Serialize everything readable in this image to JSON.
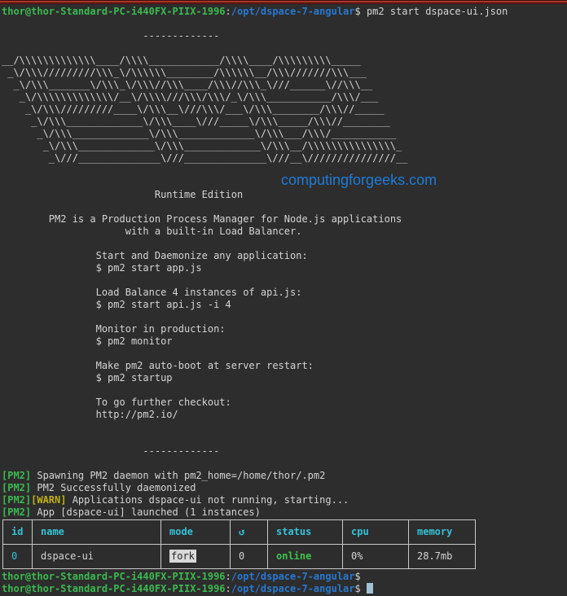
{
  "colors": {
    "background": "#2d2d2d",
    "foreground": "#d4d4d4",
    "prompt_green": "#3cb950",
    "path_blue": "#2878d0",
    "warn_yellow": "#c3b118",
    "table_cyan": "#36c2d8",
    "online_green": "#3fc24c",
    "watermark_blue": "#1e7cd8",
    "window_edge_red": "#a53527"
  },
  "watermark": "computingforgeeks.com",
  "prompt": {
    "user_host": "thor@thor-Standard-PC-i440FX-PIIX-1996",
    "colon": ":",
    "path": "/opt/dspace-7-angular",
    "dollar": "$"
  },
  "command_line": "$ pm2 start dspace-ui.json",
  "banner_and_help": [
    "",
    "",
    "                        -------------",
    "",
    "__/\\\\\\\\\\\\\\\\\\\\\\\\\\____/\\\\\\\\____________/\\\\\\\\____/\\\\\\\\\\\\\\\\\\_____",
    " _\\/\\\\\\/////////\\\\\\_\\/\\\\\\\\\\\\________/\\\\\\\\\\\\__/\\\\\\///////\\\\\\___",
    "  _\\/\\\\\\_______\\/\\\\\\_\\/\\\\\\//\\\\\\____/\\\\\\//\\\\\\_\\///______\\//\\\\\\__",
    "   _\\/\\\\\\\\\\\\\\\\\\\\\\\\\\/__\\/\\\\\\\\///\\\\\\/\\\\\\/_\\/\\\\\\___________/\\\\\\/___",
    "    _\\/\\\\\\/////////____\\/\\\\\\__\\///\\\\\\/___\\/\\\\\\________/\\\\\\//_____",
    "     _\\/\\\\\\_____________\\/\\\\\\____\\///_____\\/\\\\\\_____/\\\\\\//________",
    "      _\\/\\\\\\_____________\\/\\\\\\_____________\\/\\\\\\___/\\\\\\/___________",
    "       _\\/\\\\\\_____________\\/\\\\\\_____________\\/\\\\\\__/\\\\\\\\\\\\\\\\\\\\\\\\\\\\\\_",
    "        _\\///______________\\///______________\\///__\\///////////////__",
    "",
    "",
    "                          Runtime Edition",
    "",
    "        PM2 is a Production Process Manager for Node.js applications",
    "                     with a built-in Load Balancer.",
    "",
    "                Start and Daemonize any application:",
    "                $ pm2 start app.js",
    "",
    "                Load Balance 4 instances of api.js:",
    "                $ pm2 start api.js -i 4",
    "",
    "                Monitor in production:",
    "                $ pm2 monitor",
    "",
    "                Make pm2 auto-boot at server restart:",
    "                $ pm2 startup",
    "",
    "                To go further checkout:",
    "                http://pm2.io/",
    "",
    "",
    "                        -------------",
    "",
    ""
  ],
  "logs": {
    "tag": "[PM2]",
    "warn_tag": "[WARN]",
    "l1": " Spawning PM2 daemon with pm2_home=/home/thor/.pm2\n",
    "l2": " PM2 Successfully daemonized\n",
    "l3": " Applications dspace-ui not running, starting...\n",
    "l4": " App [dspace-ui] launched (1 instances)"
  },
  "table": {
    "headers": [
      "id",
      "name",
      "mode",
      "↺",
      "status",
      "cpu",
      "memory"
    ],
    "row": {
      "id": "0",
      "name": "dspace-ui",
      "mode": "fork",
      "restarts": "0",
      "status": "online",
      "cpu": "0%",
      "memory": "28.7mb"
    }
  }
}
